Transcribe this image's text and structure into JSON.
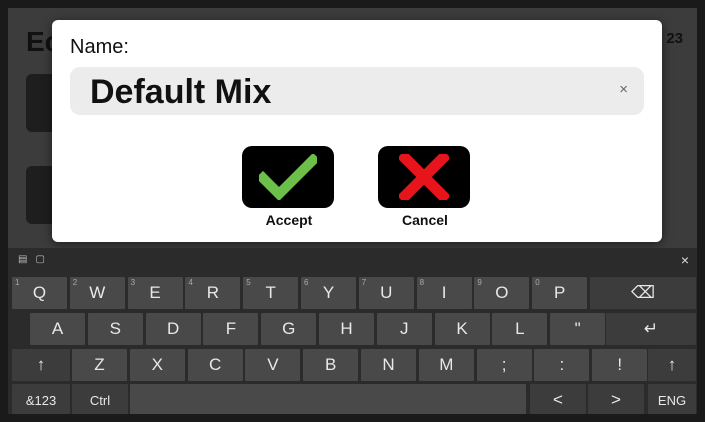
{
  "background": {
    "title_fragment": "Ec",
    "corner_fragment": "23"
  },
  "dialog": {
    "label": "Name:",
    "name_value": "Default Mix",
    "clear_glyph": "×",
    "accept_label": "Accept",
    "cancel_label": "Cancel",
    "accept_color": "#6cc04a",
    "cancel_color": "#e8141c"
  },
  "keyboard": {
    "close_glyph": "×",
    "row1": [
      {
        "label": "Q",
        "hint": "1"
      },
      {
        "label": "W",
        "hint": "2"
      },
      {
        "label": "E",
        "hint": "3"
      },
      {
        "label": "R",
        "hint": "4"
      },
      {
        "label": "T",
        "hint": "5"
      },
      {
        "label": "Y",
        "hint": "6"
      },
      {
        "label": "U",
        "hint": "7"
      },
      {
        "label": "I",
        "hint": "8"
      },
      {
        "label": "O",
        "hint": "9"
      },
      {
        "label": "P",
        "hint": "0"
      }
    ],
    "backspace": "⌫",
    "row2": [
      "A",
      "S",
      "D",
      "F",
      "G",
      "H",
      "J",
      "K",
      "L",
      "\""
    ],
    "enter": "↵",
    "shift": "↑",
    "row3": [
      "Z",
      "X",
      "C",
      "V",
      "B",
      "N",
      "M",
      ";",
      ":",
      "!"
    ],
    "symbols": "&123",
    "ctrl": "Ctrl",
    "left_arrow": "<",
    "right_arrow": ">",
    "language": "ENG"
  }
}
